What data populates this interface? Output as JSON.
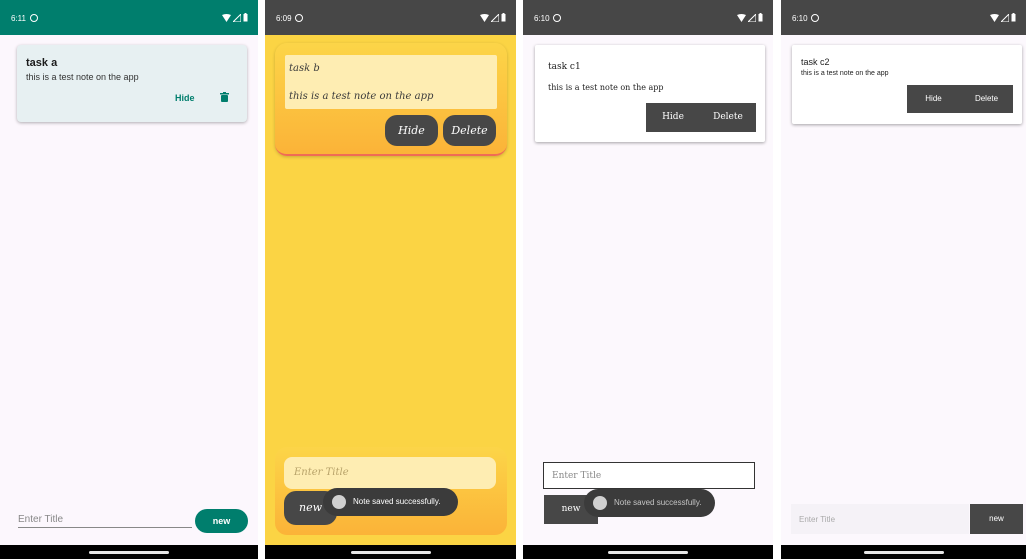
{
  "colors": {
    "teal": "#007e6d",
    "yellow": "#fbd444",
    "dark_button": "#474747",
    "background": "#fcf7fd"
  },
  "icons": {
    "notification": "circle-notification-icon",
    "wifi": "wifi-icon",
    "signal": "signal-icon",
    "battery": "battery-icon",
    "delete": "trash-icon",
    "toast": "app-icon"
  },
  "phone1": {
    "status_time": "6:11",
    "note": {
      "title": "task a",
      "body": "this is a test note on the app",
      "hide_label": "Hide"
    },
    "input_placeholder": "Enter Title",
    "new_label": "new"
  },
  "phone2": {
    "status_time": "6:09",
    "note": {
      "title": "task b",
      "body": "this is a test note on the app",
      "hide_label": "Hide",
      "delete_label": "Delete"
    },
    "input_placeholder": "Enter Title",
    "new_label": "new",
    "toast": "Note saved successfully."
  },
  "phone3": {
    "status_time": "6:10",
    "note": {
      "title": "task c1",
      "body": "this is a test note on the app",
      "hide_label": "Hide",
      "delete_label": "Delete"
    },
    "input_placeholder": "Enter Title",
    "new_label": "new",
    "toast": "Note saved successfully."
  },
  "phone4": {
    "status_time": "6:10",
    "note": {
      "title": "task c2",
      "body": "this is a test note on the app",
      "hide_label": "Hide",
      "delete_label": "Delete"
    },
    "input_placeholder": "Enter Title",
    "new_label": "new"
  }
}
